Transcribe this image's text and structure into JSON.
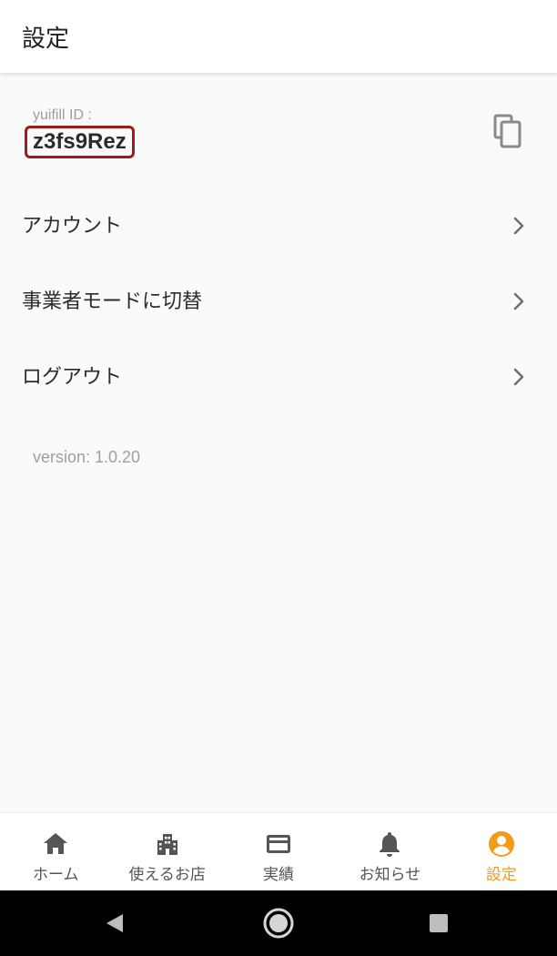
{
  "header": {
    "title": "設定"
  },
  "id_section": {
    "label": "yuifill ID :",
    "value": "z3fs9Rez",
    "copy_icon": "copy-icon"
  },
  "menu": {
    "items": [
      {
        "label": "アカウント",
        "icon": "chevron-right-icon"
      },
      {
        "label": "事業者モードに切替",
        "icon": "chevron-right-icon"
      },
      {
        "label": "ログアウト",
        "icon": "chevron-right-icon"
      }
    ]
  },
  "version_text": "version: 1.0.20",
  "bottom_nav": {
    "items": [
      {
        "label": "ホーム",
        "icon": "home-icon",
        "active": false
      },
      {
        "label": "使えるお店",
        "icon": "building-icon",
        "active": false
      },
      {
        "label": "実績",
        "icon": "credit-card-icon",
        "active": false
      },
      {
        "label": "お知らせ",
        "icon": "bell-icon",
        "active": false
      },
      {
        "label": "設定",
        "icon": "account-circle-icon",
        "active": true
      }
    ]
  },
  "system_nav": {
    "back": "back-icon",
    "home": "home-circle-icon",
    "recents": "recents-icon"
  },
  "colors": {
    "accent": "#f39a16",
    "highlight_border": "#a11a1a",
    "icon_gray": "#555555",
    "label_gray": "#9e9e9e",
    "background": "#fafafa"
  }
}
